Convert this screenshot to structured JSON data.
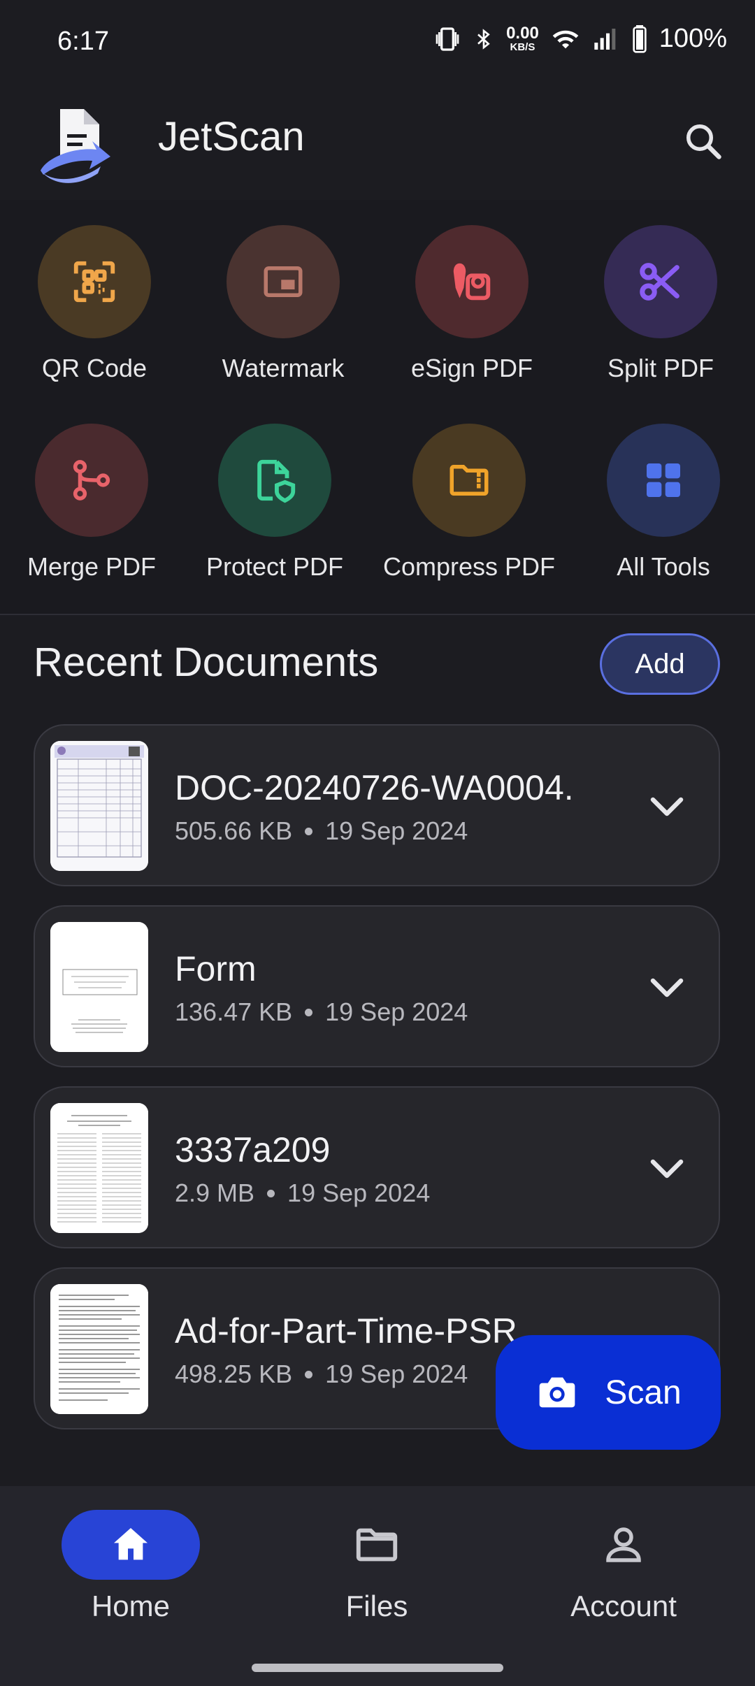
{
  "status_bar": {
    "time": "6:17",
    "net_speed_value": "0.00",
    "net_speed_unit": "KB/S",
    "battery": "100%"
  },
  "app": {
    "title": "JetScan"
  },
  "tools": [
    {
      "label": "QR Code",
      "icon": "qr-code-icon",
      "bg": "#4a3a24",
      "fg": "#f0a64a"
    },
    {
      "label": "Watermark",
      "icon": "watermark-icon",
      "bg": "#4a3330",
      "fg": "#b8786a"
    },
    {
      "label": "eSign PDF",
      "icon": "esign-icon",
      "bg": "#4f2a2e",
      "fg": "#ec5b64"
    },
    {
      "label": "Split PDF",
      "icon": "scissors-icon",
      "bg": "#352b55",
      "fg": "#8a5cf4"
    },
    {
      "label": "Merge PDF",
      "icon": "merge-icon",
      "bg": "#4a2a2e",
      "fg": "#e8636a"
    },
    {
      "label": "Protect PDF",
      "icon": "protect-icon",
      "bg": "#1f4a3d",
      "fg": "#3dd49a"
    },
    {
      "label": "Compress PDF",
      "icon": "compress-icon",
      "bg": "#4a3a22",
      "fg": "#f0a32a"
    },
    {
      "label": "All Tools",
      "icon": "grid-icon",
      "bg": "#283258",
      "fg": "#4f73ec"
    }
  ],
  "recent": {
    "title": "Recent Documents",
    "add_label": "Add"
  },
  "documents": [
    {
      "name": "DOC-20240726-WA0004.",
      "size": "505.66 KB",
      "date": "19 Sep 2024"
    },
    {
      "name": "Form",
      "size": "136.47 KB",
      "date": "19 Sep 2024"
    },
    {
      "name": "3337a209",
      "size": "2.9 MB",
      "date": "19 Sep 2024"
    },
    {
      "name": "Ad-for-Part-Time-PSR",
      "size": "498.25 KB",
      "date": "19 Sep 2024"
    }
  ],
  "fab": {
    "label": "Scan"
  },
  "nav": {
    "items": [
      {
        "label": "Home",
        "icon": "home-icon",
        "active": true
      },
      {
        "label": "Files",
        "icon": "folder-icon",
        "active": false
      },
      {
        "label": "Account",
        "icon": "account-icon",
        "active": false
      }
    ]
  }
}
